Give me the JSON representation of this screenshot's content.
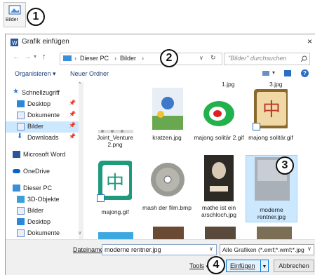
{
  "ribbon": {
    "button_label": "Bilder"
  },
  "callouts": [
    "1",
    "2",
    "3",
    "4"
  ],
  "dialog": {
    "title": "Grafik einfügen",
    "close": "×",
    "breadcrumb": [
      "Dieser PC",
      "Bilder"
    ],
    "search_placeholder": "\"Bilder\" durchsuchen",
    "organize_label": "Organisieren ▾",
    "new_folder_label": "Neuer Ordner",
    "help": "?"
  },
  "sidebar": {
    "items": [
      {
        "label": "Schnellzugriff",
        "icon": "star-icon",
        "color": "#2b7cd3"
      },
      {
        "label": "Desktop",
        "icon": "desktop-folder-icon",
        "color": "#2b88d8",
        "pin": "📌"
      },
      {
        "label": "Dokumente",
        "icon": "documents-folder-icon",
        "color": "#6b8ccf",
        "pin": "📌"
      },
      {
        "label": "Bilder",
        "icon": "pictures-folder-icon",
        "color": "#6b8ccf",
        "pin": "📌"
      },
      {
        "label": "Downloads",
        "icon": "downloads-folder-icon",
        "color": "#2b7cd3",
        "pin": "📌"
      },
      {
        "label": "Microsoft Word",
        "icon": "word-icon",
        "color": "#2b579a"
      },
      {
        "label": "OneDrive",
        "icon": "onedrive-icon",
        "color": "#0a64c8"
      },
      {
        "label": "Dieser PC",
        "icon": "computer-icon",
        "color": "#3a8fd9"
      },
      {
        "label": "3D-Objekte",
        "icon": "3d-objects-icon",
        "color": "#3aa0d9"
      },
      {
        "label": "Bilder",
        "icon": "pictures-folder-icon",
        "color": "#6b8ccf"
      },
      {
        "label": "Desktop",
        "icon": "desktop-folder-icon",
        "color": "#2b88d8"
      },
      {
        "label": "Dokumente",
        "icon": "documents-folder-icon",
        "color": "#6b8ccf"
      }
    ]
  },
  "files": {
    "top_partial": [
      "1.jpg",
      "3.jpg"
    ],
    "row1": [
      "Joint_Venture 2.png",
      "kratzen.jpg",
      "majong solitär 2.gif",
      "majong solitär.gif"
    ],
    "row2": [
      "majong.gif",
      "mash der film.bmp",
      "mathe ist ein arschloch.jpg",
      "moderne rentner.jpg"
    ]
  },
  "bottom": {
    "filename_label": "Dateiname:",
    "filename_value": "moderne rentner.jpg",
    "filetype_value": "Alle Grafiken (*.emf;*.wmf;*.jpg",
    "tools_label": "Tools",
    "insert_label": "Einfügen",
    "cancel_label": "Abbrechen"
  }
}
